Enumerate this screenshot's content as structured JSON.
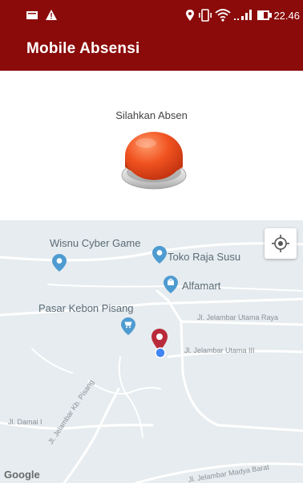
{
  "status_bar": {
    "time": "22.46",
    "left_icons": [
      "message-icon",
      "warning-icon"
    ],
    "right_icons": [
      "location-icon",
      "vibrate-icon",
      "wifi-icon",
      "signal-icon",
      "battery-icon"
    ]
  },
  "app_bar": {
    "title": "Mobile Absensi"
  },
  "attendance": {
    "prompt": "Silahkan Absen"
  },
  "map": {
    "pois": {
      "wisnu": "Wisnu Cyber Game",
      "toko": "Toko Raja Susu",
      "alfamart": "Alfamart",
      "pasar": "Pasar Kebon Pisang"
    },
    "streets": {
      "jelambar_utama_raya": "Jl. Jelambar Utama Raya",
      "jelambar_utama_iii": "Jl. Jelambar Utama III",
      "damai": "Jl. Damai I",
      "kb_pisang": "Jl. Jelambar Kb. Pisang",
      "madya_barat": "Jl. Jelambar Madya Barat"
    },
    "attribution": "Google"
  },
  "colors": {
    "brand": "#8b0a0a",
    "button": "#e8481f",
    "marker": "#b92b3b",
    "poi": "#4e9bd1"
  }
}
